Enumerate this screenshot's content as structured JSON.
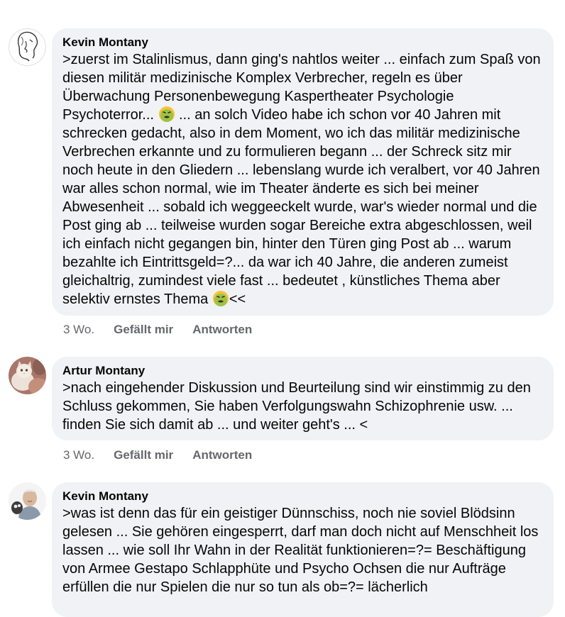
{
  "comments": [
    {
      "author": "Kevin Montany",
      "text_parts": [
        ">zuerst im Stalinlismus, dann ging's nahtlos weiter ... einfach zum Spaß von diesen militär medizinische Komplex Verbrecher, regeln es über Überwachung Personenbewegung Kaspertheater Psychologie Psychoterror... ",
        " ... an solch Video habe ich schon vor 40 Jahren mit schrecken gedacht, also in dem Moment, wo ich das militär medizinische Verbrechen erkannte und zu formulieren begann ... der Schreck sitz mir noch heute in den Gliedern ... lebenslang wurde ich veralbert, vor 40 Jahren war alles schon normal, wie im Theater änderte es sich bei meiner Abwesenheit ... sobald ich weggeeckelt wurde, war's wieder normal und die Post ging ab ... teilweise wurden sogar Bereiche extra abgeschlossen, weil ich einfach nicht gegangen bin, hinter den Türen ging Post ab ... warum bezahlte ich Eintrittsgeld=?... da war ich 40 Jahre, die anderen zumeist  gleichaltrig, zumindest viele fast ... bedeutet , künstliches Thema aber selektiv ernstes Thema ",
        "<<"
      ],
      "emoji": "nauseated-face-icon",
      "time": "3 Wo.",
      "like_label": "Gefällt mir",
      "reply_label": "Antworten"
    },
    {
      "author": "Artur Montany",
      "text": ">nach eingehender Diskussion und Beurteilung sind wir einstimmig zu den Schluss gekommen, Sie haben Verfolgungswahn Schizophrenie usw. ... finden Sie sich damit ab ... und weiter geht's ... <",
      "time": "3 Wo.",
      "like_label": "Gefällt mir",
      "reply_label": "Antworten"
    },
    {
      "author": "Kevin Montany",
      "text": ">was ist denn das für ein geistiger Dünnschiss, noch nie soviel Blödsinn gelesen ... Sie gehören eingesperrt, darf man doch nicht auf Menschheit los lassen ... wie soll Ihr Wahn in der Realität funktionieren=?= Beschäftigung von Armee Gestapo Schlapphüte und Psycho Ochsen die nur Aufträge erfüllen die nur Spielen die nur so tun als ob=?= lächerlich"
    }
  ],
  "colors": {
    "bubble": "#f0f2f5",
    "meta": "#65676b",
    "text": "#050505"
  }
}
